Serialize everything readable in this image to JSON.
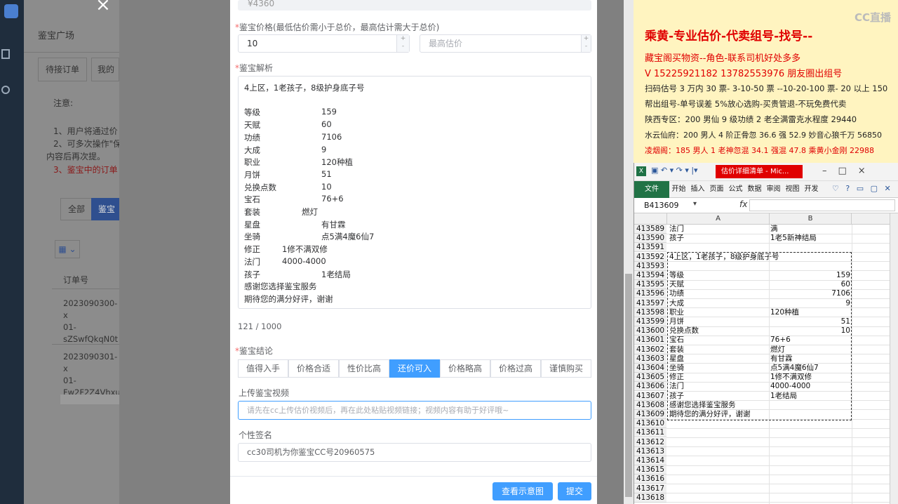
{
  "left": {
    "title": "鉴宝广场",
    "tabs": [
      "待接订单",
      "我的订"
    ],
    "notice_title": "注意:",
    "notice_lines": [
      "1、用户将通过价",
      "2、可多次操作\"保",
      "内容后再次提。",
      "3、鉴宝中的订单"
    ],
    "filter_all": "全部",
    "filter_active": "鉴宝",
    "grid_icon": "grid-icon",
    "order_header": "订单号",
    "orders": [
      {
        "line1": "2023090300-x",
        "line2": "01-",
        "line3": "sZSwfQkqN0t"
      },
      {
        "line1": "2023090301-x",
        "line2": "01-",
        "line3": "Fw2F2Z4Vhxu"
      }
    ]
  },
  "form": {
    "total_value": "¥4360",
    "price_label": "鉴宝价格(最低估价需小于总价，最高估计需大于总价)",
    "min_price_value": "10",
    "max_price_placeholder": "最高估价",
    "analysis_label": "鉴宝解析",
    "analysis_lines": [
      {
        "k": "4上区，1老孩子，8级护身底子号",
        "v": ""
      },
      {
        "k": "",
        "v": ""
      },
      {
        "k": "等级",
        "v": "159"
      },
      {
        "k": "天赋",
        "v": "60"
      },
      {
        "k": "功绩",
        "v": "7106"
      },
      {
        "k": "大成",
        "v": "9"
      },
      {
        "k": "职业",
        "v": "120种植"
      },
      {
        "k": "月饼",
        "v": "51"
      },
      {
        "k": "兑换点数",
        "v": "10"
      },
      {
        "k": "宝石",
        "v": "76+6"
      },
      {
        "k": "套装",
        "v": "燃灯"
      },
      {
        "k": "星盘",
        "v": "有甘霖"
      },
      {
        "k": "坐骑",
        "v": "点5满4魔6仙7"
      },
      {
        "k": "修正",
        "v": "1修不满双修"
      },
      {
        "k": "法门",
        "v": "4000-4000"
      },
      {
        "k": "孩子",
        "v": "1老结局"
      },
      {
        "k": "感谢您选择鉴宝服务",
        "v": ""
      },
      {
        "k": "期待您的满分好评，谢谢",
        "v": ""
      }
    ],
    "char_count": "121 / 1000",
    "conclusion_label": "鉴宝结论",
    "conclusions": [
      "值得入手",
      "价格合适",
      "性价比高",
      "还价可入",
      "价格略高",
      "价格过高",
      "谨慎购买"
    ],
    "conclusion_selected": "还价可入",
    "video_label": "上传鉴宝视频",
    "video_placeholder": "请先在cc上传估价视频后，再在此处粘贴视频链接；视频内容有助于好评哦~",
    "signature_label": "个性签名",
    "signature_value": "cc30司机为你鉴宝CC号20960575",
    "btn_sample": "查看示意图",
    "btn_submit": "提交"
  },
  "ad": {
    "watermark": "CC直播",
    "title": "乘黄-专业估价-代卖组号-找号--",
    "line1": "藏宝阁买物资--角色-联系司机好处多多",
    "line2": "V 15225921182        13782553976 朋友圈出组号",
    "line3": "扫码估号 3 万内 30 票- 3-10-50 票  --10-20-100 票- 20 以上 150",
    "line4": "帮出组号-单号误差 5%放心选购-买贵管退-不玩免费代卖",
    "line5": "陕西专区：200 男仙 9 级功绩 2 老全满雷克水程度 29440",
    "line6": "水云仙府：200 男人 4 阶正骨忽 36.6 强 52.9 妙音心狼千万 56850",
    "line7": "凌烟阁：185 男人 1 老神忽混 34.1 强混 47.8 乘黄小金刚 22988"
  },
  "excel": {
    "title": "估价详细清单 - Mic...",
    "tabs": [
      "文件",
      "开始",
      "插入",
      "页面",
      "公式",
      "数据",
      "审阅",
      "视图",
      "开发"
    ],
    "namebox": "B413609",
    "fx": "fx",
    "col_a": "A",
    "col_b": "B",
    "rows": [
      {
        "n": "413589",
        "a": "法门",
        "b": "满"
      },
      {
        "n": "413590",
        "a": "孩子",
        "b": "1老5新神结局"
      },
      {
        "n": "413591",
        "a": "",
        "b": ""
      },
      {
        "n": "413592",
        "a": "4上区，1老孩子，8级护身底子号",
        "b": ""
      },
      {
        "n": "413593",
        "a": "",
        "b": ""
      },
      {
        "n": "413594",
        "a": "等级",
        "b": "159"
      },
      {
        "n": "413595",
        "a": "天赋",
        "b": "60"
      },
      {
        "n": "413596",
        "a": "功绩",
        "b": "7106"
      },
      {
        "n": "413597",
        "a": "大成",
        "b": "9"
      },
      {
        "n": "413598",
        "a": "职业",
        "b": "120种植"
      },
      {
        "n": "413599",
        "a": "月饼",
        "b": "51"
      },
      {
        "n": "413600",
        "a": "兑换点数",
        "b": "10"
      },
      {
        "n": "413601",
        "a": "宝石",
        "b": "76+6"
      },
      {
        "n": "413602",
        "a": "套装",
        "b": "燃灯"
      },
      {
        "n": "413603",
        "a": "星盘",
        "b": "有甘霖"
      },
      {
        "n": "413604",
        "a": "坐骑",
        "b": "点5满4魔6仙7"
      },
      {
        "n": "413605",
        "a": "修正",
        "b": "1修不满双修"
      },
      {
        "n": "413606",
        "a": "法门",
        "b": "4000-4000"
      },
      {
        "n": "413607",
        "a": "孩子",
        "b": "1老结局"
      },
      {
        "n": "413608",
        "a": "感谢您选择鉴宝服务",
        "b": ""
      },
      {
        "n": "413609",
        "a": "期待您的满分好评，谢谢",
        "b": ""
      },
      {
        "n": "413610",
        "a": "",
        "b": ""
      },
      {
        "n": "413611",
        "a": "",
        "b": ""
      },
      {
        "n": "413612",
        "a": "",
        "b": ""
      },
      {
        "n": "413613",
        "a": "",
        "b": ""
      },
      {
        "n": "413614",
        "a": "",
        "b": ""
      },
      {
        "n": "413615",
        "a": "",
        "b": ""
      },
      {
        "n": "413616",
        "a": "",
        "b": ""
      },
      {
        "n": "413617",
        "a": "",
        "b": ""
      },
      {
        "n": "413618",
        "a": "",
        "b": ""
      }
    ]
  }
}
